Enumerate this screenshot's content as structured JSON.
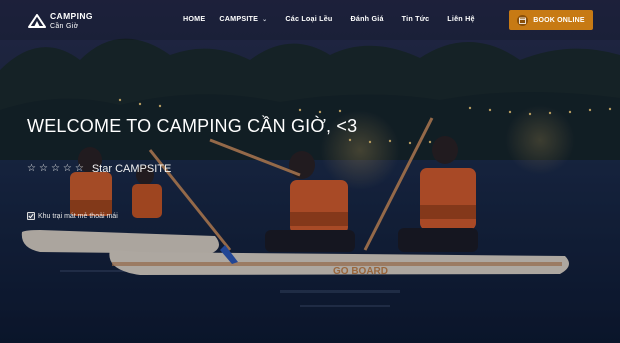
{
  "brand": {
    "title": "CAMPING",
    "subtitle": "Cần Giờ",
    "icon": "tent-icon"
  },
  "nav": {
    "items": [
      {
        "label": "HOME"
      },
      {
        "label": "CAMPSITE",
        "caret": "⌄"
      },
      {
        "label": "Các Loại Lều"
      },
      {
        "label": "Đánh Giá"
      },
      {
        "label": "Tin Tức"
      },
      {
        "label": "Liên Hệ"
      }
    ],
    "book_label": "BOOK ONLINE",
    "book_icon": "calendar-icon"
  },
  "hero": {
    "title": "WELCOME TO CAMPING CẦN GIỜ, <3",
    "rating_stars": 5,
    "rating_filled": 0,
    "rating_label": "Star CAMPSITE",
    "feature": "Khu trại mát mẻ thoải mái",
    "board_text": "GO BOARD"
  },
  "colors": {
    "accent": "#c77a14",
    "text": "#ffffff"
  }
}
